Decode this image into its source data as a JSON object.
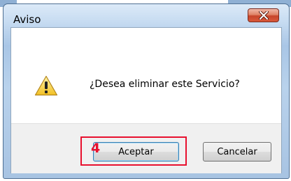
{
  "dialog": {
    "title": "Aviso",
    "message": "¿Desea eliminar este Servicio?",
    "icon": "warning-icon",
    "buttons": {
      "accept_label": "Aceptar",
      "cancel_label": "Cancelar"
    }
  },
  "annotation": {
    "step_number": "4",
    "color": "#e8102e"
  },
  "colors": {
    "close_button": "#c7452a",
    "footer": "#f0f0f0",
    "window_frame": "#a9c6e6"
  }
}
